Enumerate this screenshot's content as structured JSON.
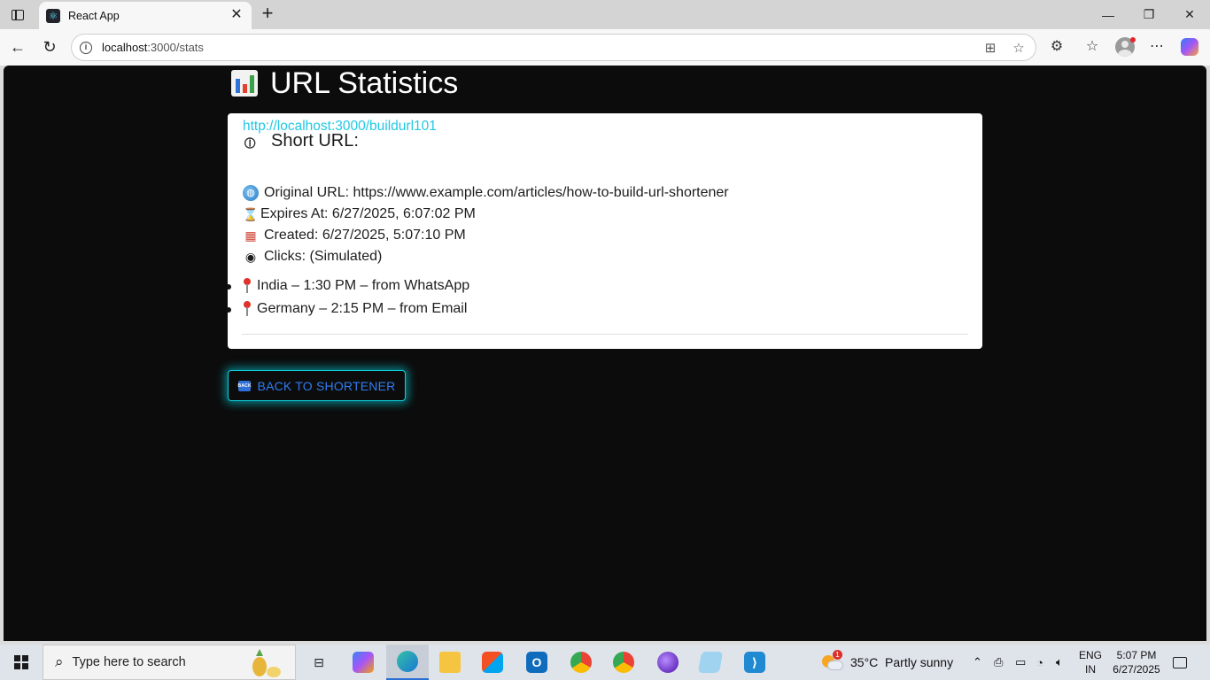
{
  "browser": {
    "tab_title": "React App",
    "url_host": "localhost",
    "url_path": ":3000/stats"
  },
  "page": {
    "title": "URL Statistics",
    "card": {
      "heading": "Short URL:",
      "short_url": "http://localhost:3000/buildurl101",
      "original_url": "Original URL: https://www.example.com/articles/how-to-build-url-shortener",
      "expires_at": "Expires At: 6/27/2025, 6:07:02 PM",
      "created": "Created: 6/27/2025, 5:07:10 PM",
      "clicks_label": "Clicks: (Simulated)",
      "clicks": [
        "India – 1:30 PM – from WhatsApp",
        "Germany – 2:15 PM – from Email"
      ]
    },
    "back_button": "BACK TO SHORTENER",
    "back_icon_text": "BACK"
  },
  "taskbar": {
    "search_placeholder": "Type here to search",
    "weather": "35°C  Partly sunny",
    "weather_badge": "1",
    "lang_line1": "ENG",
    "lang_line2": "IN",
    "time": "5:07 PM",
    "date": "6/27/2025"
  },
  "colors": {
    "page_bg": "#0c0c0c",
    "link": "#22c8e5",
    "button_glow": "#00dceb",
    "button_text": "#2f7cf0"
  }
}
